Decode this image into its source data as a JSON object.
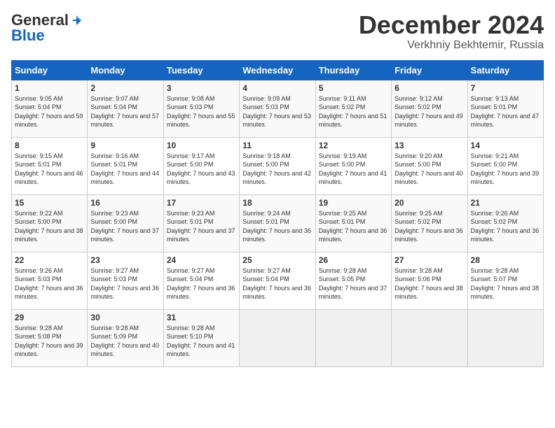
{
  "logo": {
    "general": "General",
    "blue": "Blue"
  },
  "header": {
    "month": "December 2024",
    "location": "Verkhniy Bekhtemir, Russia"
  },
  "weekdays": [
    "Sunday",
    "Monday",
    "Tuesday",
    "Wednesday",
    "Thursday",
    "Friday",
    "Saturday"
  ],
  "weeks": [
    [
      {
        "day": "1",
        "sunrise": "Sunrise: 9:05 AM",
        "sunset": "Sunset: 5:04 PM",
        "daylight": "Daylight: 7 hours and 59 minutes."
      },
      {
        "day": "2",
        "sunrise": "Sunrise: 9:07 AM",
        "sunset": "Sunset: 5:04 PM",
        "daylight": "Daylight: 7 hours and 57 minutes."
      },
      {
        "day": "3",
        "sunrise": "Sunrise: 9:08 AM",
        "sunset": "Sunset: 5:03 PM",
        "daylight": "Daylight: 7 hours and 55 minutes."
      },
      {
        "day": "4",
        "sunrise": "Sunrise: 9:09 AM",
        "sunset": "Sunset: 5:03 PM",
        "daylight": "Daylight: 7 hours and 53 minutes."
      },
      {
        "day": "5",
        "sunrise": "Sunrise: 9:11 AM",
        "sunset": "Sunset: 5:02 PM",
        "daylight": "Daylight: 7 hours and 51 minutes."
      },
      {
        "day": "6",
        "sunrise": "Sunrise: 9:12 AM",
        "sunset": "Sunset: 5:02 PM",
        "daylight": "Daylight: 7 hours and 49 minutes."
      },
      {
        "day": "7",
        "sunrise": "Sunrise: 9:13 AM",
        "sunset": "Sunset: 5:01 PM",
        "daylight": "Daylight: 7 hours and 47 minutes."
      }
    ],
    [
      {
        "day": "8",
        "sunrise": "Sunrise: 9:15 AM",
        "sunset": "Sunset: 5:01 PM",
        "daylight": "Daylight: 7 hours and 46 minutes."
      },
      {
        "day": "9",
        "sunrise": "Sunrise: 9:16 AM",
        "sunset": "Sunset: 5:01 PM",
        "daylight": "Daylight: 7 hours and 44 minutes."
      },
      {
        "day": "10",
        "sunrise": "Sunrise: 9:17 AM",
        "sunset": "Sunset: 5:00 PM",
        "daylight": "Daylight: 7 hours and 43 minutes."
      },
      {
        "day": "11",
        "sunrise": "Sunrise: 9:18 AM",
        "sunset": "Sunset: 5:00 PM",
        "daylight": "Daylight: 7 hours and 42 minutes."
      },
      {
        "day": "12",
        "sunrise": "Sunrise: 9:19 AM",
        "sunset": "Sunset: 5:00 PM",
        "daylight": "Daylight: 7 hours and 41 minutes."
      },
      {
        "day": "13",
        "sunrise": "Sunrise: 9:20 AM",
        "sunset": "Sunset: 5:00 PM",
        "daylight": "Daylight: 7 hours and 40 minutes."
      },
      {
        "day": "14",
        "sunrise": "Sunrise: 9:21 AM",
        "sunset": "Sunset: 5:00 PM",
        "daylight": "Daylight: 7 hours and 39 minutes."
      }
    ],
    [
      {
        "day": "15",
        "sunrise": "Sunrise: 9:22 AM",
        "sunset": "Sunset: 5:00 PM",
        "daylight": "Daylight: 7 hours and 38 minutes."
      },
      {
        "day": "16",
        "sunrise": "Sunrise: 9:23 AM",
        "sunset": "Sunset: 5:00 PM",
        "daylight": "Daylight: 7 hours and 37 minutes."
      },
      {
        "day": "17",
        "sunrise": "Sunrise: 9:23 AM",
        "sunset": "Sunset: 5:01 PM",
        "daylight": "Daylight: 7 hours and 37 minutes."
      },
      {
        "day": "18",
        "sunrise": "Sunrise: 9:24 AM",
        "sunset": "Sunset: 5:01 PM",
        "daylight": "Daylight: 7 hours and 36 minutes."
      },
      {
        "day": "19",
        "sunrise": "Sunrise: 9:25 AM",
        "sunset": "Sunset: 5:01 PM",
        "daylight": "Daylight: 7 hours and 36 minutes."
      },
      {
        "day": "20",
        "sunrise": "Sunrise: 9:25 AM",
        "sunset": "Sunset: 5:02 PM",
        "daylight": "Daylight: 7 hours and 36 minutes."
      },
      {
        "day": "21",
        "sunrise": "Sunrise: 9:26 AM",
        "sunset": "Sunset: 5:02 PM",
        "daylight": "Daylight: 7 hours and 36 minutes."
      }
    ],
    [
      {
        "day": "22",
        "sunrise": "Sunrise: 9:26 AM",
        "sunset": "Sunset: 5:03 PM",
        "daylight": "Daylight: 7 hours and 36 minutes."
      },
      {
        "day": "23",
        "sunrise": "Sunrise: 9:27 AM",
        "sunset": "Sunset: 5:03 PM",
        "daylight": "Daylight: 7 hours and 36 minutes."
      },
      {
        "day": "24",
        "sunrise": "Sunrise: 9:27 AM",
        "sunset": "Sunset: 5:04 PM",
        "daylight": "Daylight: 7 hours and 36 minutes."
      },
      {
        "day": "25",
        "sunrise": "Sunrise: 9:27 AM",
        "sunset": "Sunset: 5:04 PM",
        "daylight": "Daylight: 7 hours and 36 minutes."
      },
      {
        "day": "26",
        "sunrise": "Sunrise: 9:28 AM",
        "sunset": "Sunset: 5:05 PM",
        "daylight": "Daylight: 7 hours and 37 minutes."
      },
      {
        "day": "27",
        "sunrise": "Sunrise: 9:28 AM",
        "sunset": "Sunset: 5:06 PM",
        "daylight": "Daylight: 7 hours and 38 minutes."
      },
      {
        "day": "28",
        "sunrise": "Sunrise: 9:28 AM",
        "sunset": "Sunset: 5:07 PM",
        "daylight": "Daylight: 7 hours and 38 minutes."
      }
    ],
    [
      {
        "day": "29",
        "sunrise": "Sunrise: 9:28 AM",
        "sunset": "Sunset: 5:08 PM",
        "daylight": "Daylight: 7 hours and 39 minutes."
      },
      {
        "day": "30",
        "sunrise": "Sunrise: 9:28 AM",
        "sunset": "Sunset: 5:09 PM",
        "daylight": "Daylight: 7 hours and 40 minutes."
      },
      {
        "day": "31",
        "sunrise": "Sunrise: 9:28 AM",
        "sunset": "Sunset: 5:10 PM",
        "daylight": "Daylight: 7 hours and 41 minutes."
      },
      null,
      null,
      null,
      null
    ]
  ]
}
